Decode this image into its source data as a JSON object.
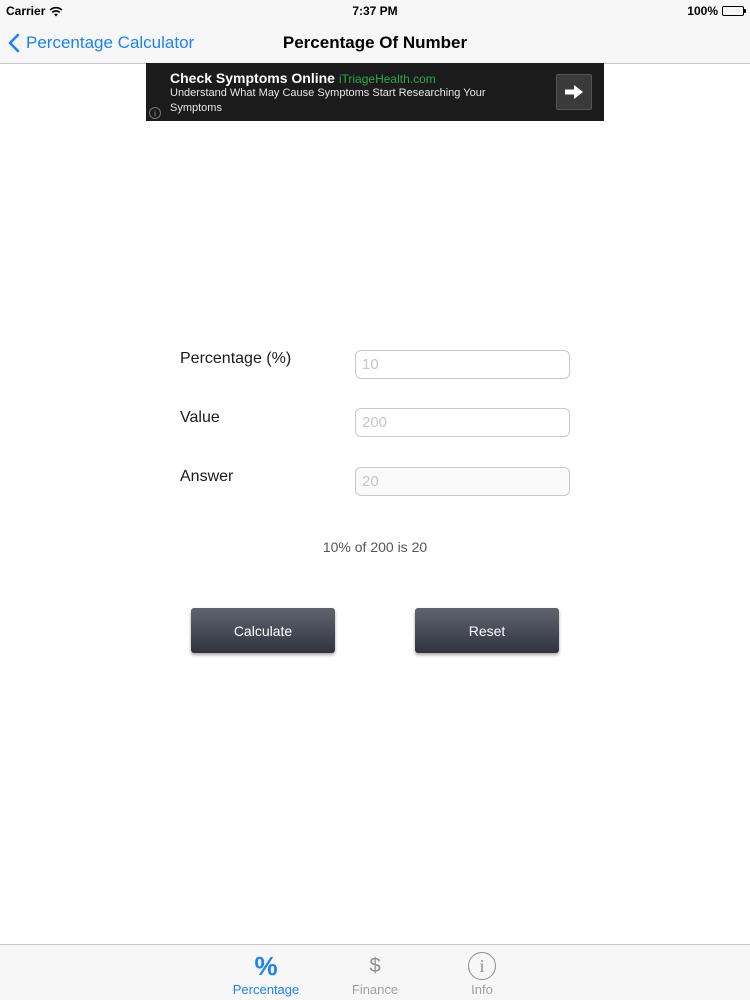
{
  "status_bar": {
    "carrier": "Carrier",
    "time": "7:37 PM",
    "battery": "100%"
  },
  "nav": {
    "back_label": "Percentage Calculator",
    "title": "Percentage Of Number"
  },
  "ad": {
    "headline": "Check Symptoms Online",
    "source": "iTriageHealth.com",
    "description": "Understand What May Cause Symptoms Start Researching Your Symptoms",
    "info_glyph": "i"
  },
  "form": {
    "percentage_label": "Percentage (%)",
    "percentage_placeholder": "10",
    "value_label": "Value",
    "value_placeholder": "200",
    "answer_label": "Answer",
    "answer_placeholder": "20"
  },
  "result_text": "10% of 200 is 20",
  "buttons": {
    "calculate": "Calculate",
    "reset": "Reset"
  },
  "tabs": [
    {
      "label": "Percentage",
      "icon": "percent-icon",
      "glyph": "%",
      "active": true
    },
    {
      "label": "Finance",
      "icon": "dollar-icon",
      "glyph": "$",
      "active": false
    },
    {
      "label": "Info",
      "icon": "info-icon",
      "glyph": "i",
      "active": false
    }
  ],
  "colors": {
    "accent": "#1a82fb",
    "inactive_tab": "#a0a0a0",
    "button_dark": "#30343d",
    "ad_background": "#1b1b1b",
    "ad_source": "#2aa84a"
  }
}
